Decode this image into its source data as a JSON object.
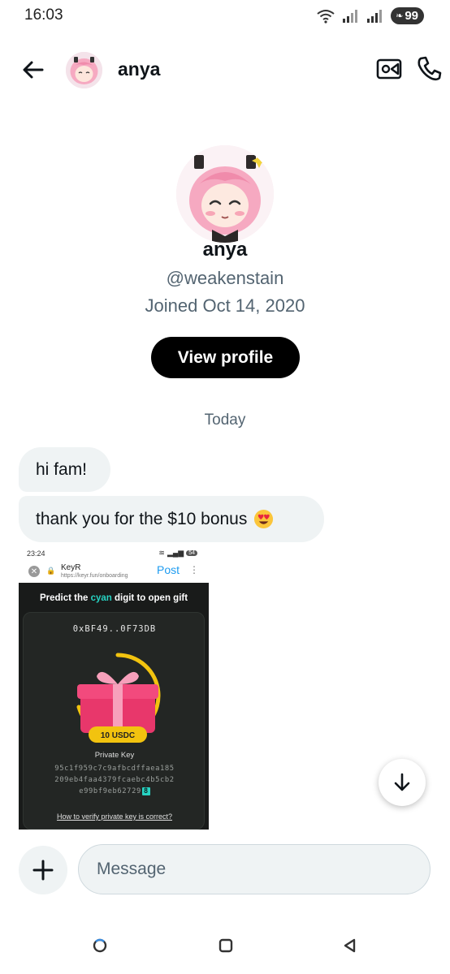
{
  "status_bar": {
    "time": "16:03",
    "battery": "99"
  },
  "header": {
    "name": "anya",
    "back_icon": "arrow-left-icon",
    "video_icon": "video-call-icon",
    "call_icon": "phone-icon"
  },
  "profile": {
    "name": "anya",
    "handle": "@weakenstain",
    "joined": "Joined Oct 14, 2020",
    "view_profile_label": "View profile"
  },
  "conversation": {
    "date_separator": "Today",
    "messages": [
      {
        "text": "hi fam!"
      },
      {
        "text": "thank you for the $10 bonus",
        "emoji": "heart-eyes-emoji"
      }
    ]
  },
  "attachment": {
    "status_time": "23:24",
    "status_battery": "54",
    "site_name": "KeyR",
    "site_url": "https://keyr.fun/onboarding",
    "post_label": "Post",
    "headline_prefix": "Predict the ",
    "headline_highlight": "cyan",
    "headline_suffix": " digit to open gift",
    "address": "0xBF49..0F73DB",
    "gift_badge": "10 USDC",
    "private_key_label": "Private Key",
    "private_key_lines": [
      "95c1f959c7c9afbcdffaea185",
      "209eb4faa4379fcaebc4b5cb2",
      "e99bf9eb62729"
    ],
    "private_key_highlight": "8",
    "verify_link": "How to verify private key is correct?",
    "accent_color": "#27d3c2"
  },
  "composer": {
    "placeholder": "Message",
    "add_icon": "plus-icon",
    "scroll_icon": "arrow-down-icon"
  },
  "colors": {
    "bubble": "#eff3f4",
    "secondary_text": "#536471",
    "primary_button": "#000000",
    "link_blue": "#1d9bf0"
  }
}
